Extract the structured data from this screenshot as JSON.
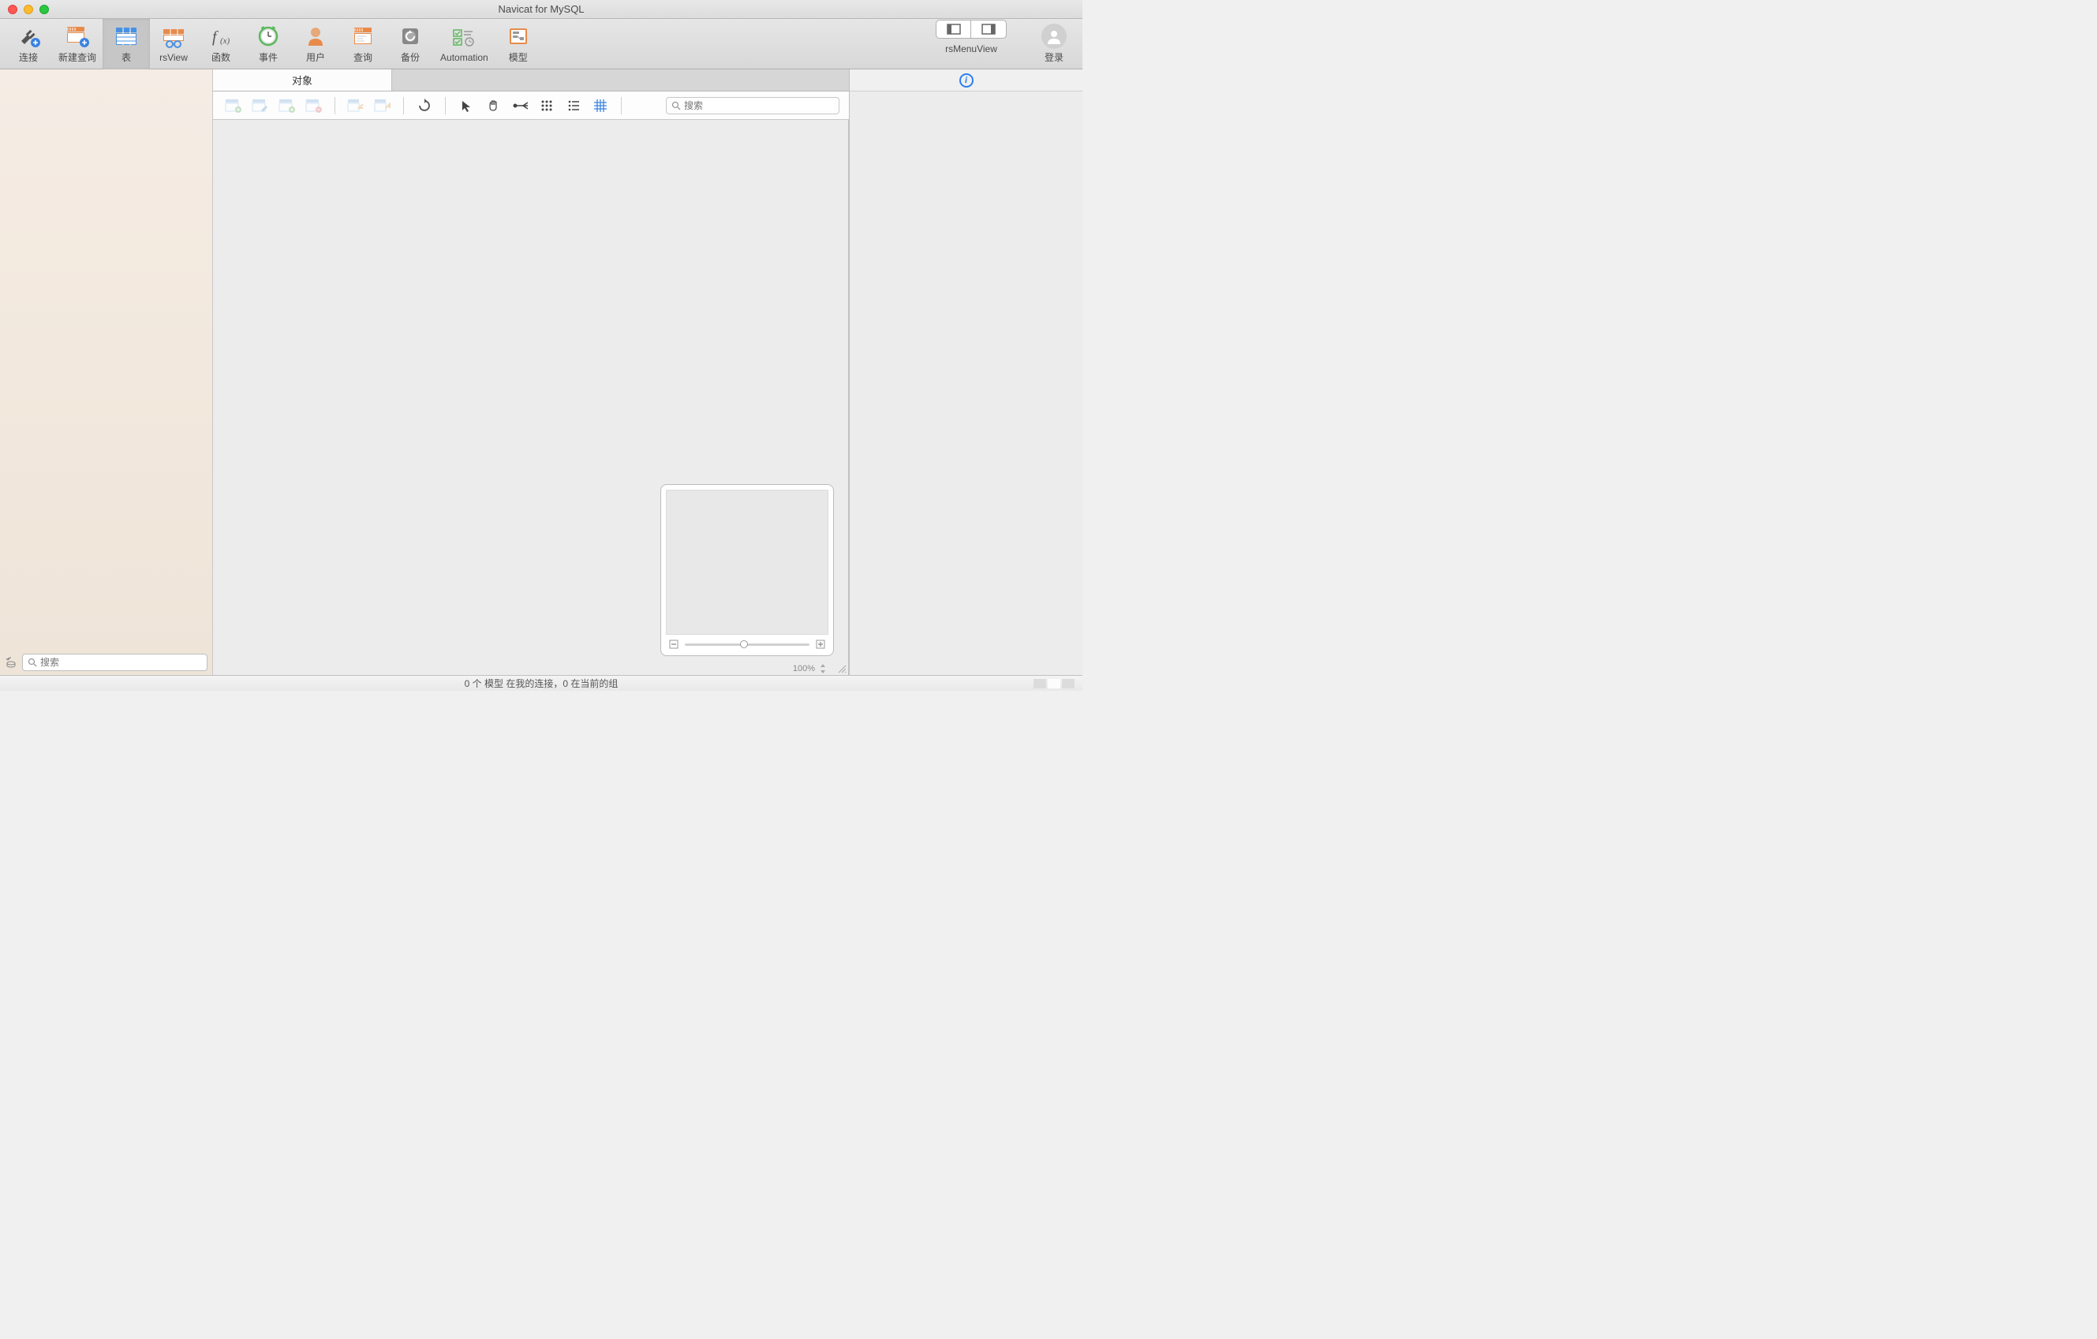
{
  "window": {
    "title": "Navicat for MySQL"
  },
  "toolbar": {
    "connection": "连接",
    "new_query": "新建查询",
    "table": "表",
    "rs_view": "rsView",
    "function": "函数",
    "event": "事件",
    "user": "用户",
    "query": "查询",
    "backup": "备份",
    "automation": "Automation",
    "model": "模型",
    "rs_menu_view": "rsMenuView",
    "login": "登录"
  },
  "tabs": {
    "objects": "对象"
  },
  "search": {
    "placeholder": "搜索"
  },
  "sub_search": {
    "placeholder": "搜索"
  },
  "zoom": {
    "value": "100%"
  },
  "statusbar": {
    "text": "0 个 模型 在我的连接，0 在当前的组"
  }
}
